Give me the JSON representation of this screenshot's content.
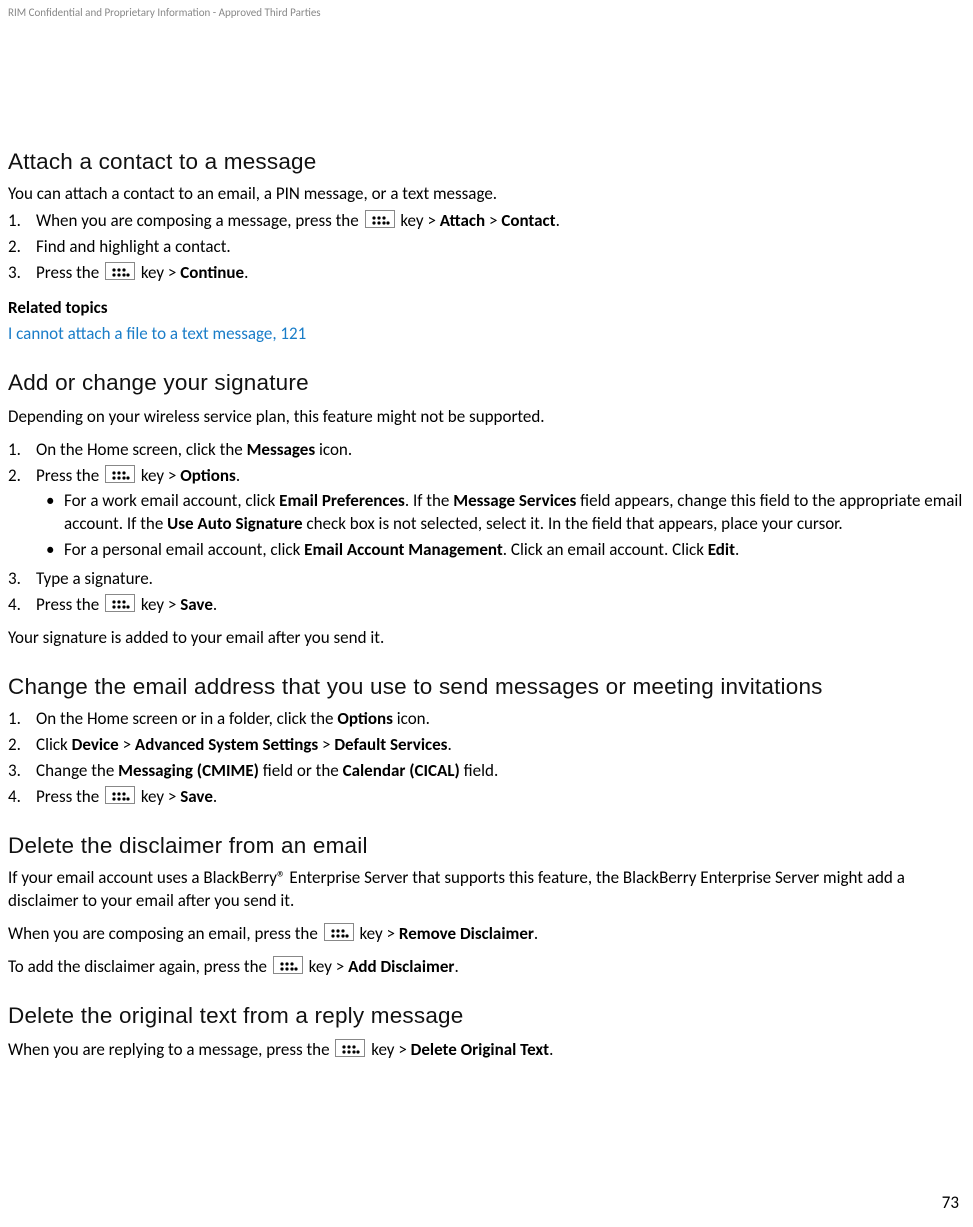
{
  "header": {
    "confidential": "RIM Confidential and Proprietary Information - Approved Third Parties"
  },
  "s1": {
    "title": "Attach a contact to a message",
    "intro": "You can attach a contact to an email, a PIN message, or a text message.",
    "step1_a": "When you are composing a message, press the ",
    "step1_b": " key > ",
    "step1_c": "Attach",
    "step1_d": " > ",
    "step1_e": "Contact",
    "step1_f": ".",
    "step2": "Find and highlight a contact.",
    "step3_a": "Press the ",
    "step3_b": " key > ",
    "step3_c": "Continue",
    "step3_d": "."
  },
  "related": {
    "heading": "Related topics",
    "link": "I cannot attach a file to a text message, 121"
  },
  "s2": {
    "title": "Add or change your signature",
    "intro": "Depending on your wireless service plan, this feature might not be supported.",
    "step1_a": "On the Home screen, click the ",
    "step1_b": "Messages",
    "step1_c": " icon.",
    "step2_a": "Press the ",
    "step2_b": " key > ",
    "step2_c": "Options",
    "step2_d": ".",
    "b1_a": "For a work email account, click ",
    "b1_b": "Email Preferences",
    "b1_c": ". If the ",
    "b1_d": "Message Services",
    "b1_e": " field appears, change this field to the appropriate email account. If the ",
    "b1_f": "Use Auto Signature",
    "b1_g": " check box is not selected, select it. In the field that appears, place your cursor.",
    "b2_a": "For a personal email account, click ",
    "b2_b": "Email Account Management",
    "b2_c": ". Click an email account. Click ",
    "b2_d": "Edit",
    "b2_e": ".",
    "step3": "Type a signature.",
    "step4_a": "Press the ",
    "step4_b": " key > ",
    "step4_c": "Save",
    "step4_d": ".",
    "outro": "Your signature is added to your email after you send it."
  },
  "s3": {
    "title": "Change the email address that you use to send messages or meeting invitations",
    "step1_a": "On the Home screen or in a folder, click the ",
    "step1_b": "Options",
    "step1_c": " icon.",
    "step2_a": "Click ",
    "step2_b": "Device",
    "step2_c": " > ",
    "step2_d": "Advanced System Settings",
    "step2_e": " > ",
    "step2_f": "Default Services",
    "step2_g": ".",
    "step3_a": "Change the ",
    "step3_b": "Messaging (CMIME)",
    "step3_c": " field or the ",
    "step3_d": "Calendar (CICAL)",
    "step3_e": " field.",
    "step4_a": "Press the ",
    "step4_b": " key > ",
    "step4_c": "Save",
    "step4_d": "."
  },
  "s4": {
    "title": "Delete the disclaimer from an email",
    "p1": "If your email account uses a BlackBerry® Enterprise Server that supports this feature, the BlackBerry Enterprise Server might add a disclaimer to your email after you send it.",
    "p2_a": "When you are composing an email, press the ",
    "p2_b": " key > ",
    "p2_c": "Remove Disclaimer",
    "p2_d": ".",
    "p3_a": "To add the disclaimer again, press the ",
    "p3_b": " key > ",
    "p3_c": "Add Disclaimer",
    "p3_d": "."
  },
  "s5": {
    "title": "Delete the original text from a reply message",
    "p1_a": "When you are replying to a message, press the ",
    "p1_b": " key > ",
    "p1_c": "Delete Original Text",
    "p1_d": "."
  },
  "footer": {
    "page": "73"
  }
}
